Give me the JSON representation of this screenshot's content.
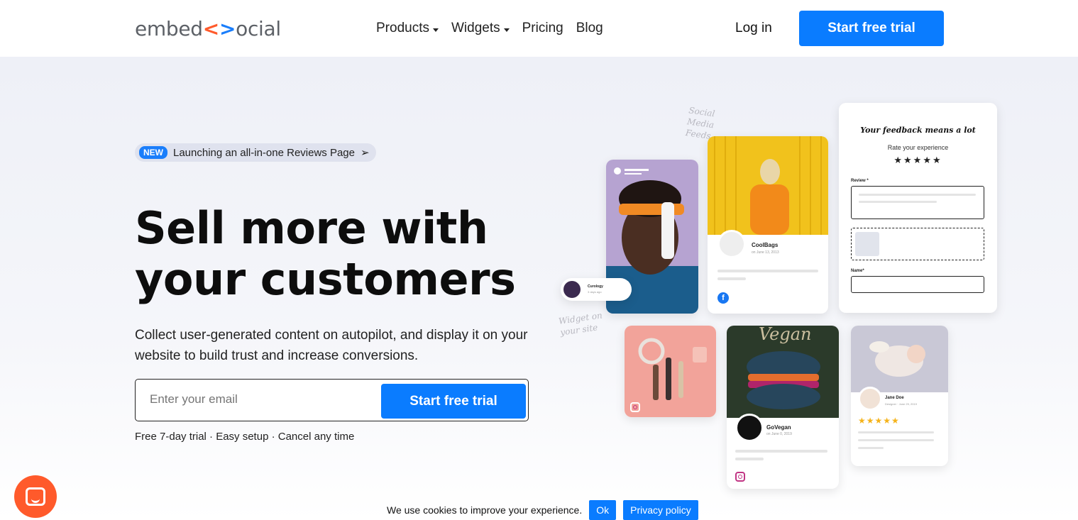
{
  "header": {
    "logo": {
      "left": "embed",
      "lt": "<",
      "gt": ">",
      "right": "ocial"
    },
    "nav": [
      {
        "label": "Products",
        "has_dropdown": true
      },
      {
        "label": "Widgets",
        "has_dropdown": true
      },
      {
        "label": "Pricing",
        "has_dropdown": false
      },
      {
        "label": "Blog",
        "has_dropdown": false
      }
    ],
    "login": "Log in",
    "cta": "Start free trial"
  },
  "hero": {
    "badge": "NEW",
    "announcement": "Launching an all-in-one Reviews Page",
    "announcement_arrow": "➢",
    "title_line1": "Sell more with",
    "title_line2": "your customers",
    "subtitle": "Collect user-generated content on autopilot, and display it on your website to build trust and increase conversions.",
    "email_placeholder": "Enter your email",
    "email_cta": "Start free trial",
    "fine_print": "Free 7-day trial · Easy setup · Cancel any time"
  },
  "illustration": {
    "note_top": "Social Media Feeds",
    "note_left": "Widget on your site",
    "story_user": {
      "name": "Curology",
      "time": "3 days ago"
    },
    "card_bags": {
      "name": "CoolBags",
      "date": "on June 13, 2013",
      "network": "facebook-icon"
    },
    "card_vegan": {
      "name": "GoVegan",
      "date": "on June 0, 2019",
      "network": "instagram-icon",
      "photo_text": "Vegan"
    },
    "card_review": {
      "name": "Jane Doe",
      "role": "Designer · June 29, 2019",
      "stars": "★★★★★"
    },
    "form": {
      "title": "Your feedback means a lot",
      "rate_label": "Rate your experience",
      "stars": "★★★★★",
      "review_label": "Review *",
      "name_label": "Name*"
    }
  },
  "cookie": {
    "text": "We use cookies to improve your experience.",
    "ok": "Ok",
    "privacy": "Privacy policy"
  },
  "colors": {
    "accent": "#0a7cff",
    "brand_orange": "#ff5a2b"
  }
}
